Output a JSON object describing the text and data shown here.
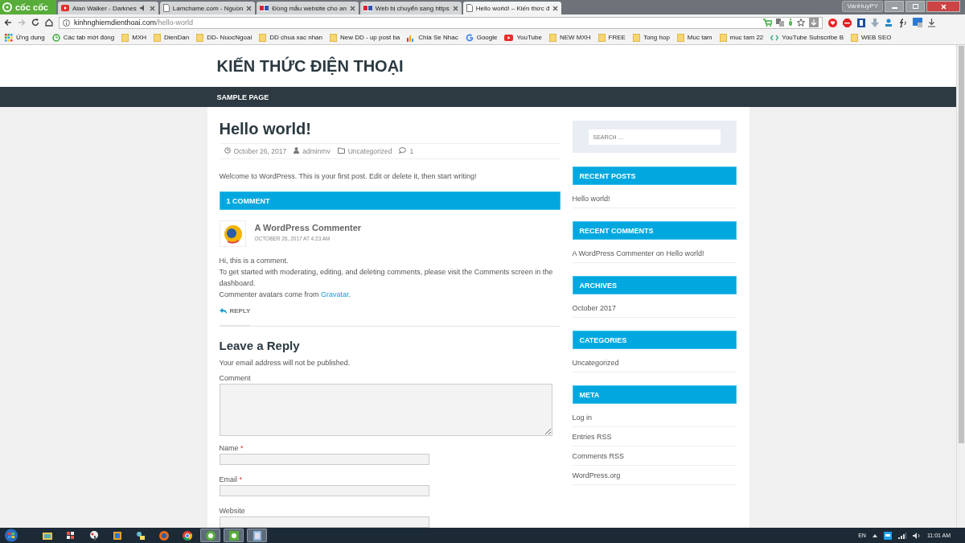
{
  "browser": {
    "logo": "cốc cốc",
    "user": "VanHuyPY",
    "tabs": [
      {
        "title": "Alan Walker - Darknes",
        "kind": "youtube",
        "audio": true,
        "selected": false
      },
      {
        "title": "Lamchame.com - Nguồn",
        "kind": "page",
        "audio": false,
        "selected": false
      },
      {
        "title": "Đồng mẫu website cho an",
        "kind": "dvs",
        "audio": false,
        "selected": false
      },
      {
        "title": "Web bị chuyển sang https",
        "kind": "dvs",
        "audio": false,
        "selected": false
      },
      {
        "title": "Hello world! – Kiến thức đ",
        "kind": "page",
        "audio": false,
        "selected": true
      }
    ],
    "url": {
      "host": "kinhnghiemdienthoai.com",
      "path": "/hello-world"
    },
    "bookmarks": [
      {
        "label": "Ứng dụng",
        "kind": "apps"
      },
      {
        "label": "Các tab mới đóng",
        "kind": "history"
      },
      {
        "label": "MXH",
        "kind": "folder"
      },
      {
        "label": "DienDan",
        "kind": "folder"
      },
      {
        "label": "DD- NuocNgoai",
        "kind": "folder"
      },
      {
        "label": "DD chua xac nhan",
        "kind": "folder"
      },
      {
        "label": "New DD - up post ba",
        "kind": "folder"
      },
      {
        "label": "Chia Se Nhac",
        "kind": "chart"
      },
      {
        "label": "Google",
        "kind": "google"
      },
      {
        "label": "YouTube",
        "kind": "youtube"
      },
      {
        "label": "NEW MXH",
        "kind": "folder"
      },
      {
        "label": "FREE",
        "kind": "folder"
      },
      {
        "label": "Tong hop",
        "kind": "folder"
      },
      {
        "label": "Muc tam",
        "kind": "folder"
      },
      {
        "label": "muc tam 22",
        "kind": "folder"
      },
      {
        "label": "YouTube Subscribe B",
        "kind": "code"
      },
      {
        "label": "WEB SEO",
        "kind": "folder"
      }
    ]
  },
  "site": {
    "title": "KIẾN THỨC ĐIỆN THOẠI",
    "menu": [
      {
        "label": "SAMPLE PAGE"
      }
    ]
  },
  "post": {
    "title": "Hello world!",
    "meta": [
      {
        "kind": "date",
        "text": "October 26, 2017"
      },
      {
        "kind": "author",
        "text": "adminmv"
      },
      {
        "kind": "category",
        "text": "Uncategorized"
      },
      {
        "kind": "comments",
        "text": "1"
      }
    ],
    "content": "Welcome to WordPress. This is your first post. Edit or delete it, then start writing!",
    "comments_title": "1 COMMENT",
    "comment": {
      "author": "A WordPress Commenter",
      "date": "OCTOBER 26, 2017 AT 4:23 AM",
      "lines": [
        {
          "text": "Hi, this is a comment."
        },
        {
          "text": "To get started with moderating, editing, and deleting comments, please visit the Comments screen in the dashboard."
        },
        {
          "text": "Commenter avatars come from ",
          "link": "Gravatar",
          "after": "."
        }
      ],
      "reply": "REPLY"
    },
    "form": {
      "heading": "Leave a Reply",
      "note": "Your email address will not be published.",
      "fields": [
        {
          "label": "Comment",
          "kind": "textarea"
        },
        {
          "label": "Name",
          "mark": "*",
          "kind": "input"
        },
        {
          "label": "Email",
          "mark": "*",
          "kind": "input"
        },
        {
          "label": "Website",
          "kind": "input"
        }
      ]
    }
  },
  "sidebar": {
    "search": {
      "placeholder": "SEARCH …"
    },
    "widgets": [
      {
        "title": "RECENT POSTS",
        "items": [
          "Hello world!"
        ]
      },
      {
        "title": "RECENT COMMENTS",
        "items": [
          "A WordPress Commenter on Hello world!"
        ]
      },
      {
        "title": "ARCHIVES",
        "items": [
          "October 2017"
        ]
      },
      {
        "title": "CATEGORIES",
        "items": [
          "Uncategorized"
        ]
      },
      {
        "title": "META",
        "items": [
          "Log in",
          "Entries RSS",
          "Comments RSS",
          "WordPress.org"
        ]
      }
    ]
  },
  "taskbar": {
    "apps": [
      {
        "kind": "explorer",
        "open": false
      },
      {
        "kind": "tiles",
        "open": false
      },
      {
        "kind": "paint",
        "open": false
      },
      {
        "kind": "square",
        "open": false
      },
      {
        "kind": "people",
        "open": false
      },
      {
        "kind": "firefox",
        "open": false
      },
      {
        "kind": "chrome",
        "open": false
      },
      {
        "kind": "coccoc",
        "open": true
      },
      {
        "kind": "coccoc2",
        "open": true
      },
      {
        "kind": "window",
        "open": true
      }
    ],
    "language": "EN",
    "time": "11:01 AM"
  }
}
